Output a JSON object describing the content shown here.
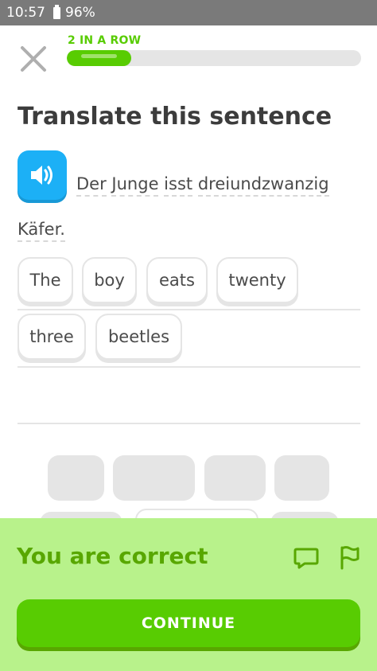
{
  "status_bar": {
    "time": "10:57",
    "battery": "96%"
  },
  "header": {
    "streak_label": "2 IN A ROW",
    "progress": 0.22
  },
  "exercise": {
    "title": "Translate this sentence",
    "sentence_words": [
      "Der",
      "Junge",
      "isst",
      "dreiundzwanzig",
      "Käfer."
    ]
  },
  "answer_tiles": [
    "The",
    "boy",
    "eats",
    "twenty",
    "three",
    "beetles"
  ],
  "result": {
    "message": "You are correct",
    "continue_label": "CONTINUE"
  },
  "colors": {
    "green": "#58cc02",
    "dark_green": "#58a700",
    "panel": "#b8f28b",
    "blue": "#1cb0f6"
  },
  "icons": [
    "close-icon",
    "speaker-icon",
    "comment-icon",
    "flag-icon"
  ]
}
